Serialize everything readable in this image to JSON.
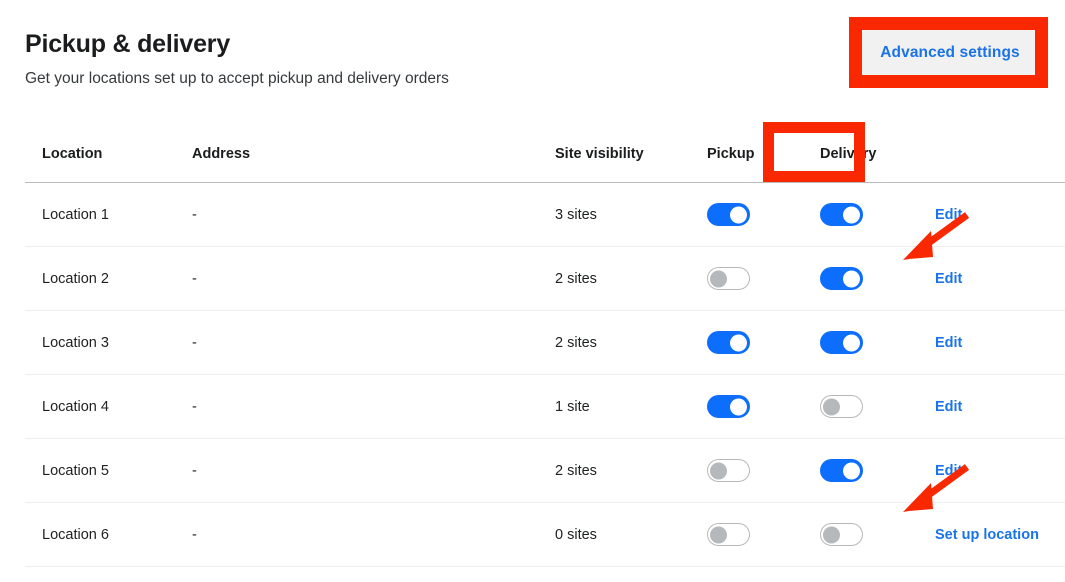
{
  "header": {
    "title": "Pickup & delivery",
    "subtitle": "Get your locations set up to accept pickup and delivery orders",
    "advanced_settings_label": "Advanced settings"
  },
  "table": {
    "columns": [
      {
        "key": "location",
        "label": "Location"
      },
      {
        "key": "address",
        "label": "Address"
      },
      {
        "key": "visibility",
        "label": "Site visibility"
      },
      {
        "key": "pickup",
        "label": "Pickup"
      },
      {
        "key": "delivery",
        "label": "Delivery"
      },
      {
        "key": "action",
        "label": ""
      }
    ],
    "rows": [
      {
        "location": "Location 1",
        "address": "-",
        "visibility": "3 sites",
        "pickup": "on",
        "delivery": "on",
        "action": "Edit"
      },
      {
        "location": "Location 2",
        "address": "-",
        "visibility": "2 sites",
        "pickup": "off",
        "delivery": "on",
        "action": "Edit"
      },
      {
        "location": "Location 3",
        "address": "-",
        "visibility": "2 sites",
        "pickup": "on",
        "delivery": "on",
        "action": "Edit"
      },
      {
        "location": "Location 4",
        "address": "-",
        "visibility": "1 site",
        "pickup": "on",
        "delivery": "off",
        "action": "Edit"
      },
      {
        "location": "Location 5",
        "address": "-",
        "visibility": "2 sites",
        "pickup": "off",
        "delivery": "on",
        "action": "Edit"
      },
      {
        "location": "Location 6",
        "address": "-",
        "visibility": "0 sites",
        "pickup": "off",
        "delivery": "off",
        "action": "Set up location"
      }
    ]
  },
  "annotations": {
    "highlight_color": "#fa2800",
    "boxes": [
      {
        "target": "advanced-settings-button"
      },
      {
        "target": "delivery-column-header"
      }
    ],
    "arrows": [
      {
        "target": "edit-link-row-2"
      },
      {
        "target": "set-up-location-link-row-6"
      }
    ]
  },
  "colors": {
    "link": "#1a73e8",
    "toggle_on": "#0d6efd",
    "toggle_off_border": "#b6b9bc",
    "button_background": "#f1f1f1"
  }
}
